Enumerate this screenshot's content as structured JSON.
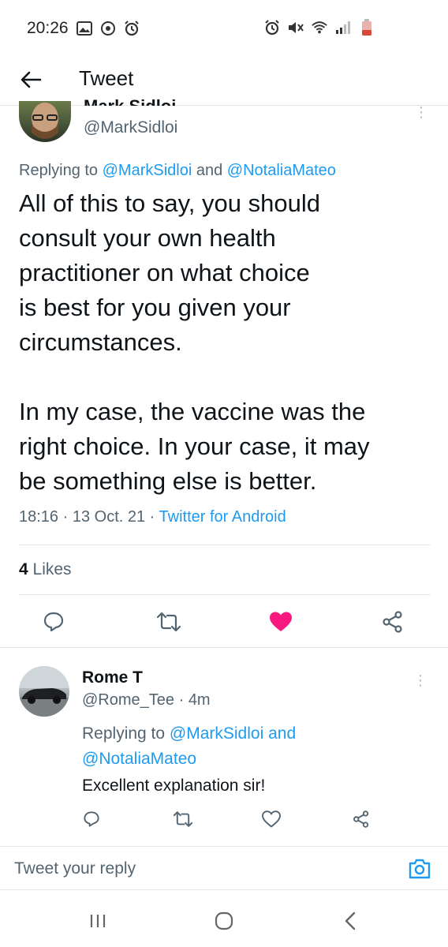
{
  "status_bar": {
    "time": "20:26",
    "left_icons": [
      "gallery-icon",
      "sync-icon",
      "alarm-icon"
    ],
    "right_icons": [
      "alarm-icon",
      "mute-icon",
      "wifi-icon",
      "signal-icon",
      "battery-icon"
    ]
  },
  "header": {
    "back_icon": "back-arrow-icon",
    "title": "Tweet"
  },
  "main_tweet": {
    "author_name": "Mark Sidloi",
    "author_handle": "@MarkSidloi",
    "replying_prefix": "Replying to ",
    "replying_mention_1": "@MarkSidloi",
    "replying_and": " and ",
    "replying_mention_2": "@NotaliaMateo",
    "text": "All of this to say, you should\nconsult your own health\npractitioner on what choice\nis best for you given your\ncircumstances.\n\nIn my case, the vaccine was the\nright choice. In your case, it may\nbe something else is better.",
    "time": "18:16",
    "date": "13 Oct. 21",
    "source": "Twitter for Android",
    "likes_count": "4",
    "likes_label": "Likes",
    "liked": true,
    "accent_color": "#1d9bf0",
    "like_color": "#f91880"
  },
  "reply": {
    "author_name": "Rome T",
    "author_handle": "@Rome_Tee",
    "age": "4m",
    "replying_prefix": "Replying to ",
    "replying_mention_1": "@MarkSidloi",
    "replying_and": " and",
    "replying_mention_2": "@NotaliaMateo",
    "text": "Excellent explanation sir!"
  },
  "compose": {
    "placeholder": "Tweet your reply",
    "camera_icon": "camera-icon"
  },
  "nav": {
    "recents_icon": "recents-icon",
    "home_icon": "home-icon",
    "back_icon": "back-icon"
  }
}
